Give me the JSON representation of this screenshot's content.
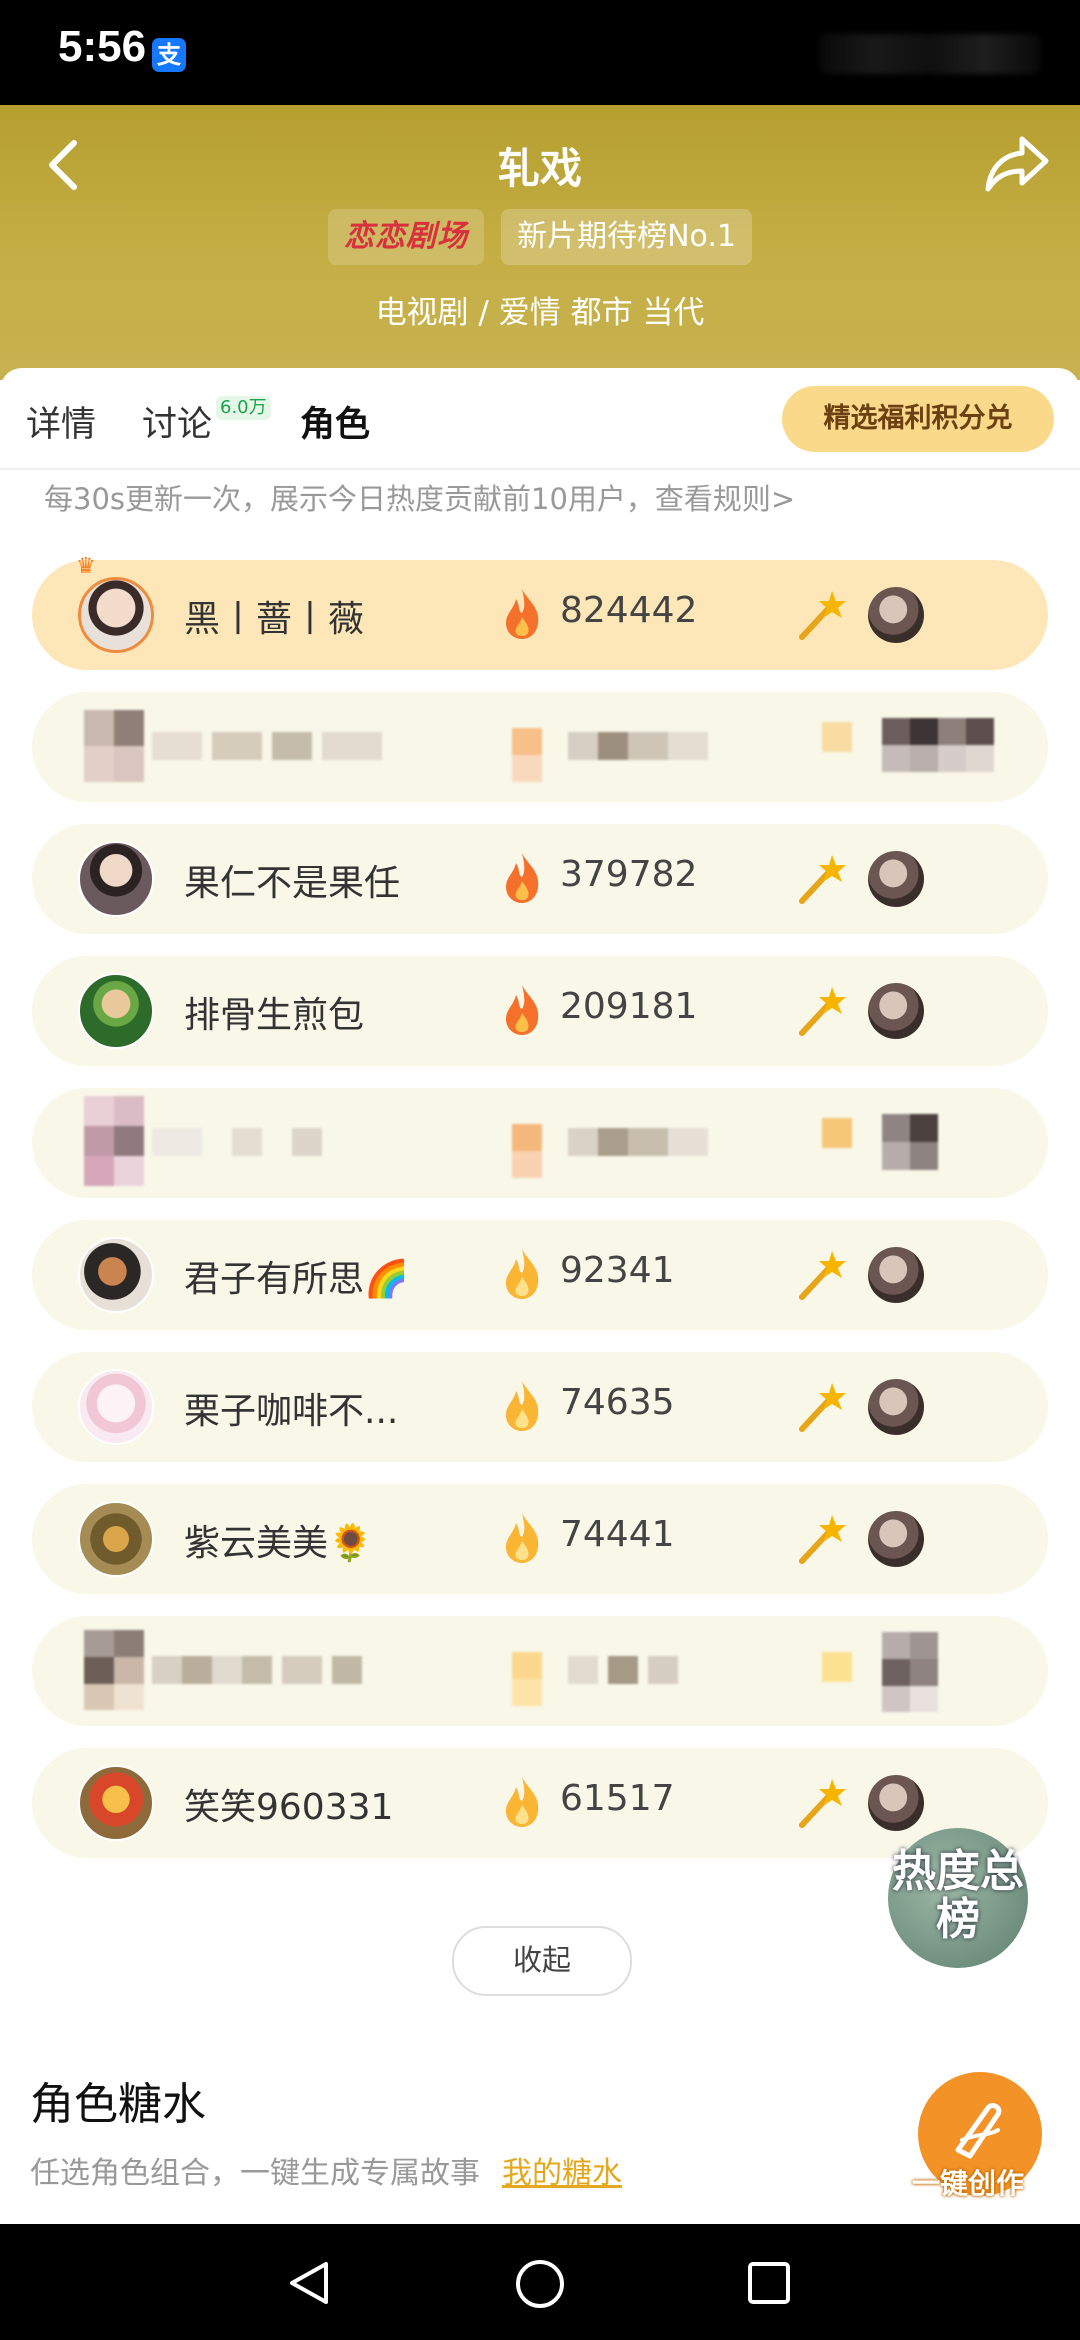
{
  "status_bar": {
    "time": "5:56",
    "app_badge": "支"
  },
  "header": {
    "title": "轧戏",
    "brand_badge": "恋恋剧场",
    "rank_badge": "新片期待榜No.1",
    "genre": "电视剧 / 爱情 都市 当代"
  },
  "tabs": [
    {
      "label": "详情"
    },
    {
      "label": "讨论",
      "badge": "6.0万"
    },
    {
      "label": "角色"
    }
  ],
  "redeem_button": "精选福利积分兑",
  "notice": "每30s更新一次，展示今日热度贡献前10用户，查看规则>",
  "leaderboard": [
    {
      "name": "黑丨蔷丨薇",
      "score": "824442"
    },
    {
      "name": "",
      "score": ""
    },
    {
      "name": "果仁不是果任",
      "score": "379782"
    },
    {
      "name": "排骨生煎包",
      "score": "209181"
    },
    {
      "name": "",
      "score": ""
    },
    {
      "name": "君子有所思🌈",
      "score": "92341"
    },
    {
      "name": "栗子咖啡不...",
      "score": "74635"
    },
    {
      "name": "紫云美美🌻",
      "score": "74441"
    },
    {
      "name": "",
      "score": ""
    },
    {
      "name": "笑笑960331",
      "score": "61517"
    }
  ],
  "collapse_button": "收起",
  "hot_total_button": "热度总榜",
  "sugar_section": {
    "title": "角色糖水",
    "subtitle": "任选角色组合，一键生成专属故事",
    "link": "我的糖水"
  },
  "create_button": "一键创作",
  "colors": {
    "header_gold": "#c1aa40",
    "accent_orange": "#f39226",
    "first_row": "#fde7b8",
    "row_bg": "#f8f7e8"
  }
}
